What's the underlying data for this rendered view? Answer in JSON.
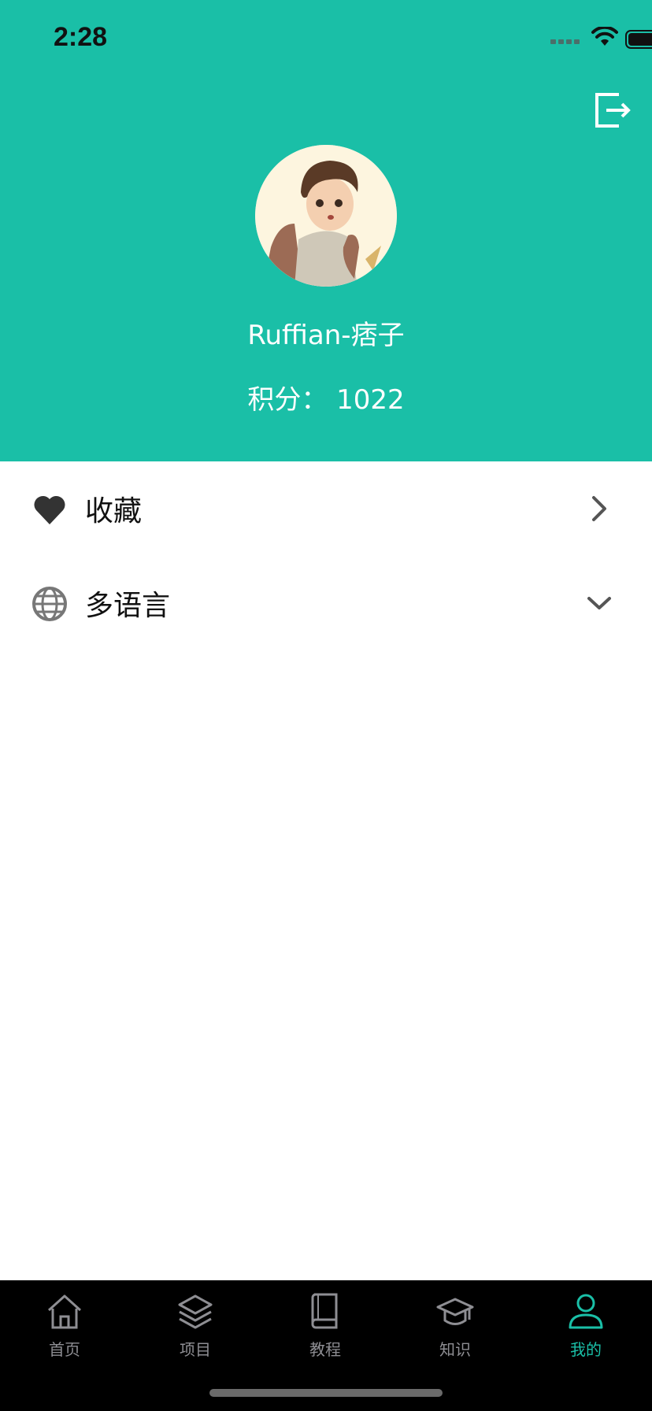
{
  "status_bar": {
    "time": "2:28"
  },
  "profile": {
    "username": "Ruffian-痞子",
    "points": "积分：  1022"
  },
  "menu": [
    {
      "label": "收藏",
      "icon": "heart-icon"
    },
    {
      "label": "多语言",
      "icon": "globe-icon"
    }
  ],
  "tabbar": {
    "items": [
      {
        "label": "首页",
        "icon": "home-icon"
      },
      {
        "label": "项目",
        "icon": "layers-icon"
      },
      {
        "label": "教程",
        "icon": "book-icon"
      },
      {
        "label": "知识",
        "icon": "graduation-cap-icon"
      },
      {
        "label": "我的",
        "icon": "user-icon",
        "active": true
      }
    ]
  },
  "colors": {
    "primary": "#1abfa7",
    "tabbar_bg": "#000000",
    "inactive": "#8e8e93"
  }
}
